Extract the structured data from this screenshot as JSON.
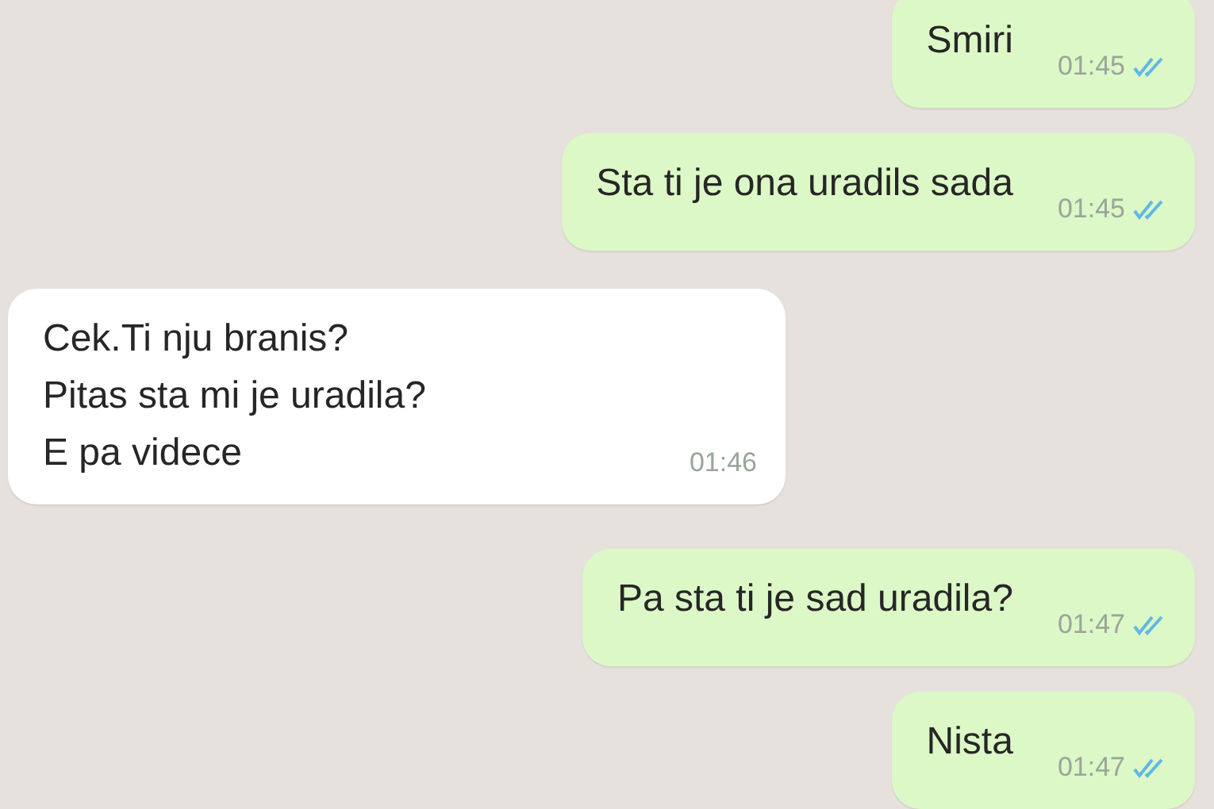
{
  "messages": [
    {
      "kind": "outgoing",
      "text": "Smiri",
      "time": "01:45",
      "read": true
    },
    {
      "kind": "outgoing",
      "text": "Sta ti je ona uradils sada",
      "time": "01:45",
      "read": true
    },
    {
      "kind": "incoming",
      "text": "Cek.Ti nju branis?\nPitas sta mi je uradila?\nE pa videce",
      "time": "01:46"
    },
    {
      "kind": "outgoing",
      "text": "Pa sta ti je sad uradila?",
      "time": "01:47",
      "read": true
    },
    {
      "kind": "outgoing",
      "text": "Nista",
      "time": "01:47",
      "read": true
    }
  ]
}
